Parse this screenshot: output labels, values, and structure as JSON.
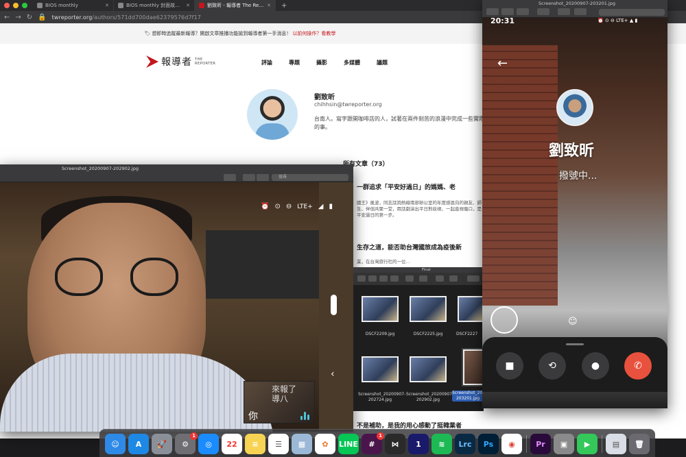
{
  "browser": {
    "tabs": [
      {
        "title": "BIOS monthly",
        "active": false
      },
      {
        "title": "BIOS monthly 封面故事 AW - M",
        "active": false
      },
      {
        "title": "劉致昕 - 報導者 The Reporter",
        "active": true
      }
    ],
    "new_tab": "+",
    "url_host": "twreporter.org",
    "url_path": "/authors/571dd700dae62379576d7f17",
    "banner": {
      "icon": "🏷",
      "text": "想即時追蹤最新報導？開啟文章推播功能搶到報導者第一手消息！",
      "link": "以前何操作？看教學"
    }
  },
  "site": {
    "logo_cn": "報導者",
    "logo_en_1": "THE",
    "logo_en_2": "REPORTER",
    "menu": [
      "評論",
      "專題",
      "攝影",
      "多媒體",
      "議題"
    ],
    "author": {
      "name": "劉致昕",
      "email": "chihhsin@twreporter.org",
      "bio": "台南人。寫字跟開咖啡店的人，試著在兩件刻苦的浪漫中完成一些實際的事。"
    },
    "all_articles_label": "所有文章（73）",
    "articles": [
      {
        "title": "一群追求「平安好過日」的媽媽、老",
        "desc": "國王》風波，同志話詢熱線南部辦公室的年度感恩向的親友、師生、伴侶共聚一堂，用話劇演出平日對歧視、一起直視傷口，是平安過日的第一步。"
      },
      {
        "title": "生存之道，能否助台灣國旅成為疫後新",
        "desc": "業，在台灣旅行社的一位…"
      },
      {
        "title": "不是補助，是我的用心感動了挺韓業者",
        "desc": ""
      }
    ]
  },
  "preview_left": {
    "title": "Screenshot_20200907-202902.jpg",
    "search_placeholder": "搜尋",
    "status_lte": "LTE+",
    "pip_text": "來報了導八",
    "pip_ni": "你"
  },
  "finder": {
    "title": "Final",
    "files": [
      {
        "name": "DSCF2209.jpg"
      },
      {
        "name": "DSCF2225.jpg"
      },
      {
        "name": "DSCF2227"
      },
      {
        "name": "Screenshot_20200907-202724.jpg"
      },
      {
        "name": "Screenshot_20200907-202902.jpg"
      },
      {
        "name": "Screenshot_20200907-203201.jpg",
        "selected": true
      }
    ]
  },
  "preview_right": {
    "title": "Screenshot_20200907-203201.jpg",
    "time": "20:31",
    "status_right": "⏰ ⊙ ⊖ LTE+ ▲ ▮",
    "contact_name": "劉致昕",
    "call_status": "撥號中...",
    "controls": [
      "video-camera-icon",
      "switch-camera-icon",
      "microphone-icon",
      "end-call-icon"
    ]
  },
  "dock": {
    "apps": [
      {
        "name": "finder",
        "label": "☺",
        "color": "#2e8ae6"
      },
      {
        "name": "app-store",
        "label": "A",
        "color": "#1e88e5"
      },
      {
        "name": "launchpad",
        "label": "🚀",
        "color": "#8a8f98"
      },
      {
        "name": "system-preferences",
        "label": "⚙",
        "color": "#6e6e73",
        "badge": "1"
      },
      {
        "name": "safari",
        "label": "◎",
        "color": "#1a8cff"
      },
      {
        "name": "calendar",
        "label": "22",
        "color": "#ffffff",
        "text_color": "#e33",
        "sub": "9月"
      },
      {
        "name": "notes",
        "label": "≡",
        "color": "#f7d354"
      },
      {
        "name": "reminders",
        "label": "☰",
        "color": "#ffffff",
        "text_color": "#555"
      },
      {
        "name": "preview",
        "label": "▦",
        "color": "#9bb8d6"
      },
      {
        "name": "photos",
        "label": "✿",
        "color": "#ffffff",
        "text_color": "#e87b2a"
      },
      {
        "name": "line",
        "label": "LINE",
        "color": "#06c755"
      },
      {
        "name": "slack",
        "label": "#",
        "color": "#4a154b",
        "badge": "1"
      },
      {
        "name": "mango",
        "label": "⋈",
        "color": "#2a2a2a"
      },
      {
        "name": "1password",
        "label": "1",
        "color": "#1a1a6a"
      },
      {
        "name": "spotify",
        "label": "≋",
        "color": "#1db954"
      },
      {
        "name": "lightroom-classic",
        "label": "Lrc",
        "color": "#0a2a44",
        "text_color": "#6ec0ff"
      },
      {
        "name": "photoshop",
        "label": "Ps",
        "color": "#001e36",
        "text_color": "#31a8ff"
      },
      {
        "name": "chrome",
        "label": "◉",
        "color": "#ffffff",
        "text_color": "#db4437"
      },
      {
        "name": "premiere",
        "label": "Pr",
        "color": "#2a0a3a",
        "text_color": "#e08fff"
      },
      {
        "name": "photo-booth",
        "label": "▣",
        "color": "#8a8a8a"
      },
      {
        "name": "facetime",
        "label": "▶",
        "color": "#34c759"
      },
      {
        "name": "documents",
        "label": "▤",
        "color": "#d8dde6",
        "text_color": "#555"
      },
      {
        "name": "trash",
        "label": "🗑",
        "color": "#6a6a70"
      }
    ]
  }
}
